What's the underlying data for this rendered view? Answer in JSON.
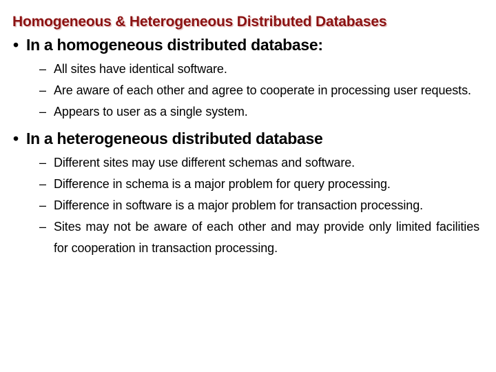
{
  "slide": {
    "title": "Homogeneous & Heterogeneous Distributed Databases",
    "title_color": "#8B1212",
    "title_shadow_color": "#D29696",
    "body_color": "#000000",
    "background_color": "#FFFFFF",
    "bullet_glyph": "•",
    "dash_glyph": "–",
    "sections": [
      {
        "heading": "In a homogeneous distributed database:",
        "items": [
          "All sites have identical software.",
          "Are aware of each other and agree to cooperate in processing user requests.",
          "Appears to user as a single system."
        ]
      },
      {
        "heading": "In a heterogeneous distributed database",
        "items": [
          "Different sites may use different schemas and software.",
          "Difference in schema is a major problem for query processing.",
          "Difference in software is a major problem for transaction processing.",
          "Sites may not be aware of each other and may provide only limited facilities for cooperation in transaction processing."
        ]
      }
    ]
  }
}
